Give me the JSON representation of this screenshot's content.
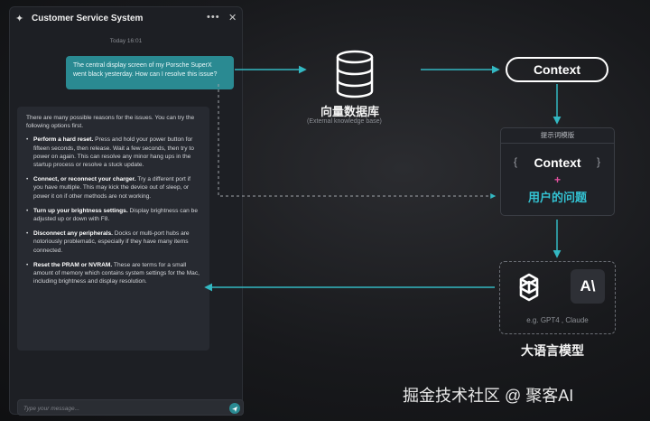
{
  "chat": {
    "title": "Customer Service System",
    "timestamp": "Today 16:01",
    "user_message": "The central display screen of my Porsche SuperX went black yesterday. How can I resolve this issue?",
    "bot_intro": "There are many possible reasons for the issues. You can try the following options first.",
    "bot_items": [
      {
        "title": "Perform a hard reset.",
        "text": " Press and hold your power button for fifteen seconds, then release. Wait a few seconds, then try to power on again. This can resolve any minor hang ups in the startup process or resolve a stuck update."
      },
      {
        "title": "Connect, or reconnect your charger.",
        "text": " Try a different port if you have multiple. This may kick the device out of sleep, or power it on if other methods are not working."
      },
      {
        "title": "Turn up your brightness settings.",
        "text": "  Display brightness can be adjusted up or down with F8."
      },
      {
        "title": "Disconnect any peripherals.",
        "text": " Docks or multi-port hubs are notoriously problematic, especially if they have many items connected."
      },
      {
        "title": "Reset the PRAM or NVRAM.",
        "text": " These are terms for a small amount of memory which contains system settings for the Mac, including brightness and display resolution."
      }
    ],
    "input_placeholder": "Type your message...",
    "icons": {
      "header": "sparkle-icon",
      "more": "more-icon",
      "close": "close-icon",
      "send": "send-icon"
    }
  },
  "diagram": {
    "database_title": "向量数据库",
    "database_subtitle": "(External knowledge base)",
    "context_label": "Context",
    "prompt_template": {
      "header": "提示词模版",
      "open_brace": "{",
      "close_brace": "}",
      "context": "Context",
      "plus": "+",
      "question": "用户的问题"
    },
    "llm": {
      "examples": "e.g.  GPT4 , Claude",
      "claude_logo_text": "A\\",
      "title": "大语言模型"
    },
    "colors": {
      "accent": "#2a8a92",
      "arrow": "#33b8c2",
      "plus": "#e0509e",
      "question": "#33c3d3"
    }
  },
  "watermark": "掘金技术社区 @ 聚客AI"
}
